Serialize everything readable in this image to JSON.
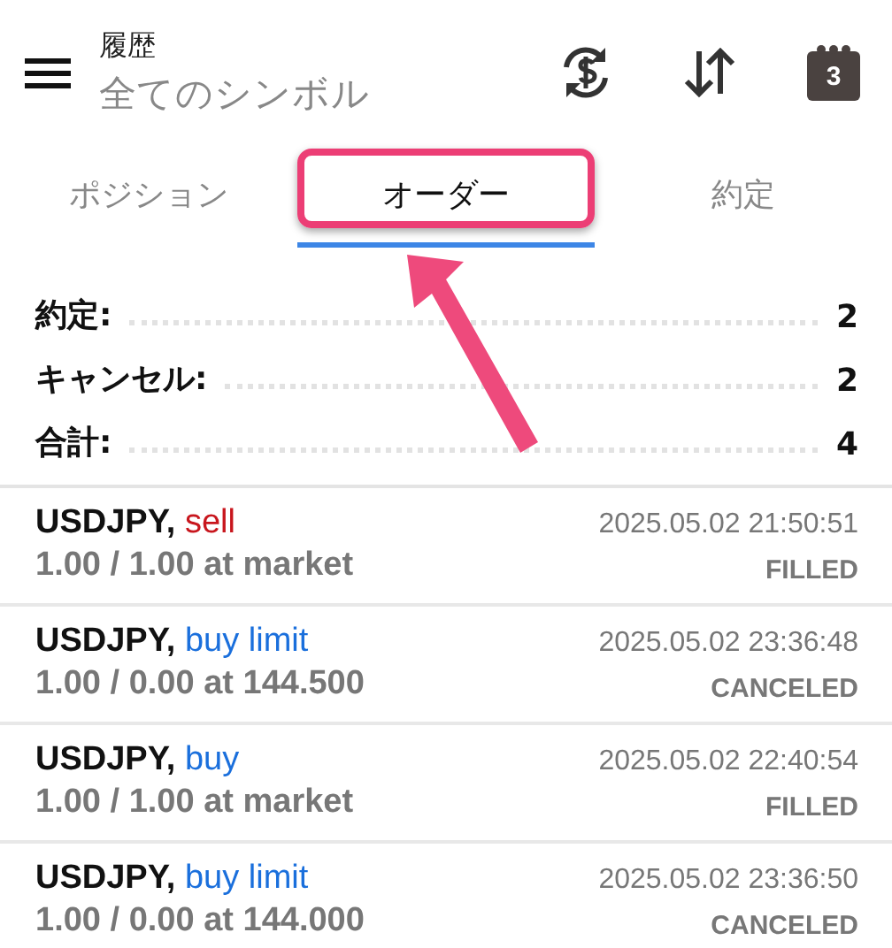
{
  "header": {
    "title": "履歴",
    "subtitle": "全てのシンボル",
    "calendar_day": "3"
  },
  "tabs": [
    {
      "label": "ポジション",
      "selected": false,
      "highlighted": false
    },
    {
      "label": "オーダー",
      "selected": true,
      "highlighted": true
    },
    {
      "label": "約定",
      "selected": false,
      "highlighted": false
    }
  ],
  "summary": [
    {
      "label": "約定:",
      "value": "2"
    },
    {
      "label": "キャンセル:",
      "value": "2"
    },
    {
      "label": "合計:",
      "value": "4"
    }
  ],
  "orders": [
    {
      "symbol": "USDJPY,",
      "side": "sell",
      "kind": "sell",
      "volume": "1.00 / 1.00 at market",
      "time": "2025.05.02 21:50:51",
      "status": "FILLED"
    },
    {
      "symbol": "USDJPY,",
      "side": "buy limit",
      "kind": "buy",
      "volume": "1.00 / 0.00 at 144.500",
      "time": "2025.05.02 23:36:48",
      "status": "CANCELED"
    },
    {
      "symbol": "USDJPY,",
      "side": "buy",
      "kind": "buy",
      "volume": "1.00 / 1.00 at market",
      "time": "2025.05.02 22:40:54",
      "status": "FILLED"
    },
    {
      "symbol": "USDJPY,",
      "side": "buy limit",
      "kind": "buy",
      "volume": "1.00 / 0.00 at 144.000",
      "time": "2025.05.02 23:36:50",
      "status": "CANCELED"
    }
  ]
}
